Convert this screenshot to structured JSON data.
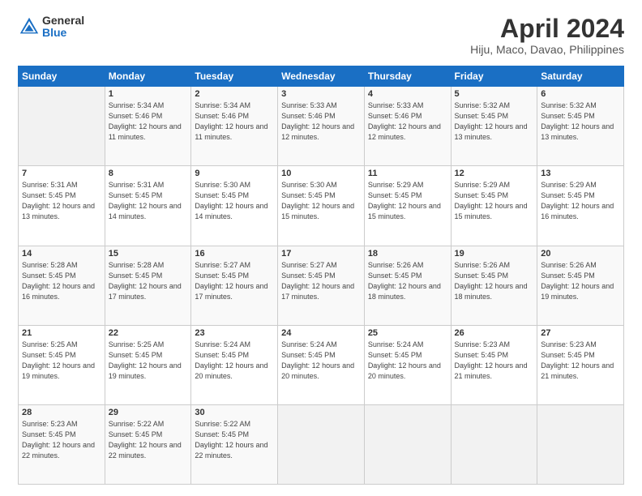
{
  "header": {
    "logo_general": "General",
    "logo_blue": "Blue",
    "title": "April 2024",
    "subtitle": "Hiju, Maco, Davao, Philippines"
  },
  "days_of_week": [
    "Sunday",
    "Monday",
    "Tuesday",
    "Wednesday",
    "Thursday",
    "Friday",
    "Saturday"
  ],
  "weeks": [
    [
      {
        "day": "",
        "sunrise": "",
        "sunset": "",
        "daylight": "",
        "empty": true
      },
      {
        "day": "1",
        "sunrise": "Sunrise: 5:34 AM",
        "sunset": "Sunset: 5:46 PM",
        "daylight": "Daylight: 12 hours and 11 minutes.",
        "empty": false
      },
      {
        "day": "2",
        "sunrise": "Sunrise: 5:34 AM",
        "sunset": "Sunset: 5:46 PM",
        "daylight": "Daylight: 12 hours and 11 minutes.",
        "empty": false
      },
      {
        "day": "3",
        "sunrise": "Sunrise: 5:33 AM",
        "sunset": "Sunset: 5:46 PM",
        "daylight": "Daylight: 12 hours and 12 minutes.",
        "empty": false
      },
      {
        "day": "4",
        "sunrise": "Sunrise: 5:33 AM",
        "sunset": "Sunset: 5:46 PM",
        "daylight": "Daylight: 12 hours and 12 minutes.",
        "empty": false
      },
      {
        "day": "5",
        "sunrise": "Sunrise: 5:32 AM",
        "sunset": "Sunset: 5:45 PM",
        "daylight": "Daylight: 12 hours and 13 minutes.",
        "empty": false
      },
      {
        "day": "6",
        "sunrise": "Sunrise: 5:32 AM",
        "sunset": "Sunset: 5:45 PM",
        "daylight": "Daylight: 12 hours and 13 minutes.",
        "empty": false
      }
    ],
    [
      {
        "day": "7",
        "sunrise": "Sunrise: 5:31 AM",
        "sunset": "Sunset: 5:45 PM",
        "daylight": "Daylight: 12 hours and 13 minutes.",
        "empty": false
      },
      {
        "day": "8",
        "sunrise": "Sunrise: 5:31 AM",
        "sunset": "Sunset: 5:45 PM",
        "daylight": "Daylight: 12 hours and 14 minutes.",
        "empty": false
      },
      {
        "day": "9",
        "sunrise": "Sunrise: 5:30 AM",
        "sunset": "Sunset: 5:45 PM",
        "daylight": "Daylight: 12 hours and 14 minutes.",
        "empty": false
      },
      {
        "day": "10",
        "sunrise": "Sunrise: 5:30 AM",
        "sunset": "Sunset: 5:45 PM",
        "daylight": "Daylight: 12 hours and 15 minutes.",
        "empty": false
      },
      {
        "day": "11",
        "sunrise": "Sunrise: 5:29 AM",
        "sunset": "Sunset: 5:45 PM",
        "daylight": "Daylight: 12 hours and 15 minutes.",
        "empty": false
      },
      {
        "day": "12",
        "sunrise": "Sunrise: 5:29 AM",
        "sunset": "Sunset: 5:45 PM",
        "daylight": "Daylight: 12 hours and 15 minutes.",
        "empty": false
      },
      {
        "day": "13",
        "sunrise": "Sunrise: 5:29 AM",
        "sunset": "Sunset: 5:45 PM",
        "daylight": "Daylight: 12 hours and 16 minutes.",
        "empty": false
      }
    ],
    [
      {
        "day": "14",
        "sunrise": "Sunrise: 5:28 AM",
        "sunset": "Sunset: 5:45 PM",
        "daylight": "Daylight: 12 hours and 16 minutes.",
        "empty": false
      },
      {
        "day": "15",
        "sunrise": "Sunrise: 5:28 AM",
        "sunset": "Sunset: 5:45 PM",
        "daylight": "Daylight: 12 hours and 17 minutes.",
        "empty": false
      },
      {
        "day": "16",
        "sunrise": "Sunrise: 5:27 AM",
        "sunset": "Sunset: 5:45 PM",
        "daylight": "Daylight: 12 hours and 17 minutes.",
        "empty": false
      },
      {
        "day": "17",
        "sunrise": "Sunrise: 5:27 AM",
        "sunset": "Sunset: 5:45 PM",
        "daylight": "Daylight: 12 hours and 17 minutes.",
        "empty": false
      },
      {
        "day": "18",
        "sunrise": "Sunrise: 5:26 AM",
        "sunset": "Sunset: 5:45 PM",
        "daylight": "Daylight: 12 hours and 18 minutes.",
        "empty": false
      },
      {
        "day": "19",
        "sunrise": "Sunrise: 5:26 AM",
        "sunset": "Sunset: 5:45 PM",
        "daylight": "Daylight: 12 hours and 18 minutes.",
        "empty": false
      },
      {
        "day": "20",
        "sunrise": "Sunrise: 5:26 AM",
        "sunset": "Sunset: 5:45 PM",
        "daylight": "Daylight: 12 hours and 19 minutes.",
        "empty": false
      }
    ],
    [
      {
        "day": "21",
        "sunrise": "Sunrise: 5:25 AM",
        "sunset": "Sunset: 5:45 PM",
        "daylight": "Daylight: 12 hours and 19 minutes.",
        "empty": false
      },
      {
        "day": "22",
        "sunrise": "Sunrise: 5:25 AM",
        "sunset": "Sunset: 5:45 PM",
        "daylight": "Daylight: 12 hours and 19 minutes.",
        "empty": false
      },
      {
        "day": "23",
        "sunrise": "Sunrise: 5:24 AM",
        "sunset": "Sunset: 5:45 PM",
        "daylight": "Daylight: 12 hours and 20 minutes.",
        "empty": false
      },
      {
        "day": "24",
        "sunrise": "Sunrise: 5:24 AM",
        "sunset": "Sunset: 5:45 PM",
        "daylight": "Daylight: 12 hours and 20 minutes.",
        "empty": false
      },
      {
        "day": "25",
        "sunrise": "Sunrise: 5:24 AM",
        "sunset": "Sunset: 5:45 PM",
        "daylight": "Daylight: 12 hours and 20 minutes.",
        "empty": false
      },
      {
        "day": "26",
        "sunrise": "Sunrise: 5:23 AM",
        "sunset": "Sunset: 5:45 PM",
        "daylight": "Daylight: 12 hours and 21 minutes.",
        "empty": false
      },
      {
        "day": "27",
        "sunrise": "Sunrise: 5:23 AM",
        "sunset": "Sunset: 5:45 PM",
        "daylight": "Daylight: 12 hours and 21 minutes.",
        "empty": false
      }
    ],
    [
      {
        "day": "28",
        "sunrise": "Sunrise: 5:23 AM",
        "sunset": "Sunset: 5:45 PM",
        "daylight": "Daylight: 12 hours and 22 minutes.",
        "empty": false
      },
      {
        "day": "29",
        "sunrise": "Sunrise: 5:22 AM",
        "sunset": "Sunset: 5:45 PM",
        "daylight": "Daylight: 12 hours and 22 minutes.",
        "empty": false
      },
      {
        "day": "30",
        "sunrise": "Sunrise: 5:22 AM",
        "sunset": "Sunset: 5:45 PM",
        "daylight": "Daylight: 12 hours and 22 minutes.",
        "empty": false
      },
      {
        "day": "",
        "sunrise": "",
        "sunset": "",
        "daylight": "",
        "empty": true
      },
      {
        "day": "",
        "sunrise": "",
        "sunset": "",
        "daylight": "",
        "empty": true
      },
      {
        "day": "",
        "sunrise": "",
        "sunset": "",
        "daylight": "",
        "empty": true
      },
      {
        "day": "",
        "sunrise": "",
        "sunset": "",
        "daylight": "",
        "empty": true
      }
    ]
  ]
}
